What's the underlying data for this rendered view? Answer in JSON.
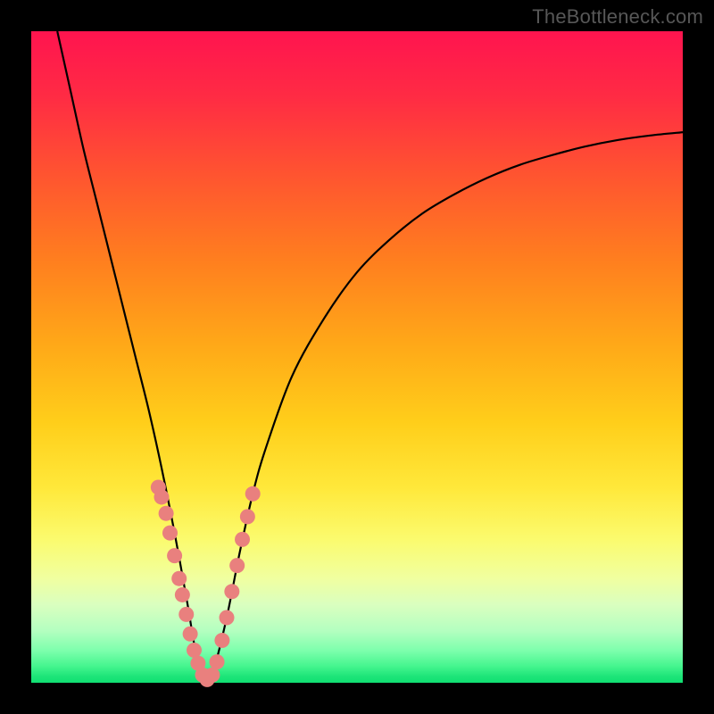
{
  "watermark": "TheBottleneck.com",
  "colors": {
    "background": "#000000",
    "marker": "#e9807e",
    "curve": "#000000",
    "gradient_top": "#ff144f",
    "gradient_bottom": "#10df72"
  },
  "chart_data": {
    "type": "line",
    "title": "",
    "xlabel": "",
    "ylabel": "",
    "xlim": [
      0,
      100
    ],
    "ylim": [
      0,
      100
    ],
    "grid": false,
    "series": [
      {
        "name": "bottleneck-curve",
        "x": [
          4,
          6,
          8,
          10,
          12,
          14,
          16,
          18,
          20,
          22,
          24,
          25,
          26,
          27,
          28,
          30,
          32,
          34,
          36,
          40,
          45,
          50,
          55,
          60,
          65,
          70,
          75,
          80,
          85,
          90,
          95,
          100
        ],
        "y": [
          100,
          91,
          82,
          74,
          66,
          58,
          50,
          42,
          33,
          23,
          12,
          6,
          2,
          0.5,
          2,
          10,
          20,
          29,
          36,
          47,
          56,
          63,
          68,
          72,
          75,
          77.5,
          79.5,
          81,
          82.3,
          83.3,
          84,
          84.5
        ],
        "note": "Percent-scale V-shaped bottleneck curve; y=100 is top of plot, y=0 is bottom. Minimum (optimal point) near x≈27."
      }
    ],
    "markers": {
      "name": "cluster-points",
      "note": "Salmon dots clustered near the curve minimum on both arms.",
      "points_xy_percent": [
        [
          19.5,
          30
        ],
        [
          20.0,
          28.5
        ],
        [
          20.7,
          26
        ],
        [
          21.3,
          23
        ],
        [
          22.0,
          19.5
        ],
        [
          22.7,
          16
        ],
        [
          23.2,
          13.5
        ],
        [
          23.8,
          10.5
        ],
        [
          24.4,
          7.5
        ],
        [
          25.0,
          5
        ],
        [
          25.6,
          3
        ],
        [
          26.3,
          1.2
        ],
        [
          27.0,
          0.5
        ],
        [
          27.8,
          1.2
        ],
        [
          28.5,
          3.2
        ],
        [
          29.3,
          6.5
        ],
        [
          30.0,
          10
        ],
        [
          30.8,
          14
        ],
        [
          31.6,
          18
        ],
        [
          32.4,
          22
        ],
        [
          33.2,
          25.5
        ],
        [
          34.0,
          29
        ]
      ]
    }
  }
}
